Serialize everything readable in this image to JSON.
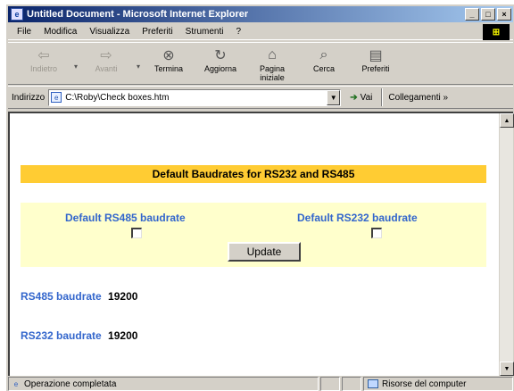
{
  "window": {
    "title": "Untitled Document - Microsoft Internet Explorer",
    "controls": {
      "minimize": "_",
      "maximize": "□",
      "close": "×"
    }
  },
  "menu": {
    "items": [
      "File",
      "Modifica",
      "Visualizza",
      "Preferiti",
      "Strumenti",
      "?"
    ]
  },
  "toolbar": {
    "back": "Indietro",
    "forward": "Avanti",
    "stop": "Termina",
    "refresh": "Aggiorna",
    "home": "Pagina iniziale",
    "search": "Cerca",
    "favorites": "Preferiti"
  },
  "address": {
    "label": "Indirizzo",
    "url": "C:\\Roby\\Check boxes.htm",
    "go": "Vai",
    "links": "Collegamenti »"
  },
  "page": {
    "banner": "Default Baudrates for RS232 and RS485",
    "default_rs485_label": "Default RS485 baudrate",
    "default_rs232_label": "Default RS232 baudrate",
    "default_rs485_checked": false,
    "default_rs232_checked": false,
    "update_button": "Update",
    "rs485_label": "RS485 baudrate",
    "rs485_value": "19200",
    "rs232_label": "RS232 baudrate",
    "rs232_value": "19200"
  },
  "status": {
    "text": "Operazione completata",
    "zone": "Risorse del computer"
  }
}
